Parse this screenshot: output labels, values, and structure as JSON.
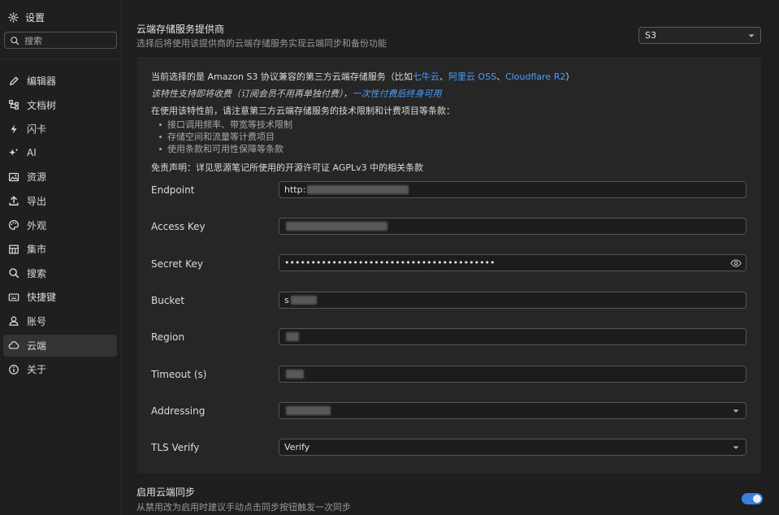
{
  "sidebar": {
    "header": {
      "label": "设置",
      "icon": "gear-icon"
    },
    "search": {
      "placeholder": "搜索"
    },
    "items": [
      {
        "label": "编辑器",
        "icon": "pencil-icon"
      },
      {
        "label": "文档树",
        "icon": "tree-icon"
      },
      {
        "label": "闪卡",
        "icon": "lightning-icon"
      },
      {
        "label": "AI",
        "icon": "sparkle-icon"
      },
      {
        "label": "资源",
        "icon": "image-icon"
      },
      {
        "label": "导出",
        "icon": "upload-icon"
      },
      {
        "label": "外观",
        "icon": "palette-icon"
      },
      {
        "label": "集市",
        "icon": "store-icon"
      },
      {
        "label": "搜索",
        "icon": "search-icon"
      },
      {
        "label": "快捷键",
        "icon": "keyboard-icon"
      },
      {
        "label": "账号",
        "icon": "user-icon"
      },
      {
        "label": "云端",
        "icon": "cloud-icon",
        "active": true
      },
      {
        "label": "关于",
        "icon": "info-icon"
      }
    ]
  },
  "provider": {
    "title": "云端存储服务提供商",
    "subtitle": "选择后将使用该提供商的云端存储服务实现云端同步和备份功能",
    "selected": "S3"
  },
  "panel": {
    "intro_prefix": "当前选择的是 Amazon S3 协议兼容的第三方云端存储服务（比如",
    "link_qiniu": "七牛云",
    "sep1": "、",
    "link_aliyun": "阿里云 OSS",
    "sep2": "、",
    "link_cloudflare": "Cloudflare R2",
    "intro_suffix": "）",
    "paid_notice": "该特性支持即将收费（订阅会员不用再单独付费），",
    "paid_link": "一次性付费后终身可用",
    "terms_intro": "在使用该特性前，请注意第三方云端存储服务的技术限制和计费项目等条款：",
    "bullets": [
      "接口调用频率、带宽等技术限制",
      "存储空间和流量等计费项目",
      "使用条款和可用性保障等条款"
    ],
    "disclaimer": "免责声明：详见思源笔记所使用的开源许可证 AGPLv3 中的相关条款"
  },
  "form": {
    "endpoint": {
      "label": "Endpoint",
      "value_prefix": "http:"
    },
    "access_key": {
      "label": "Access Key",
      "value_prefix": ""
    },
    "secret_key": {
      "label": "Secret Key",
      "value": "••••••••••••••••••••••••••••••••••••••••"
    },
    "bucket": {
      "label": "Bucket",
      "value_prefix": "s"
    },
    "region": {
      "label": "Region",
      "value_prefix": ""
    },
    "timeout": {
      "label": "Timeout (s)",
      "value_prefix": ""
    },
    "addressing": {
      "label": "Addressing",
      "value_prefix": ""
    },
    "tls_verify": {
      "label": "TLS Verify",
      "value": "Verify"
    }
  },
  "sync": {
    "title": "启用云端同步",
    "subtitle": "从禁用改为启用时建议手动点击同步按钮触发一次同步",
    "enabled": true
  },
  "colors": {
    "accent": "#4a9eff",
    "toggle": "#3d7fe0"
  }
}
